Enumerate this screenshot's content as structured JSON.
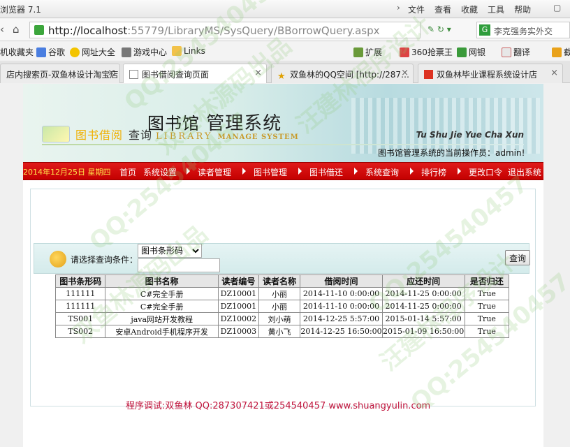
{
  "browser": {
    "app_title": "浏览器 7.1",
    "menu": [
      "文件",
      "查看",
      "收藏",
      "工具",
      "帮助"
    ],
    "url_host": "http://localhost",
    "url_path": ":55779/LibraryMS/SysQuery/BBorrowQuery.aspx",
    "search_text": "李克强务实外交",
    "bookmarks": [
      "机收藏夹",
      "谷歌",
      "网址大全",
      "游戏中心",
      "Links",
      "扩展",
      "360抢票王",
      "网银",
      "翻译",
      "截"
    ],
    "tabs": [
      {
        "label": "店内搜索页-双鱼林设计淘宝店",
        "active": false
      },
      {
        "label": "图书借阅查询页面",
        "active": true
      },
      {
        "label": "双鱼林的QQ空间 [http://287…",
        "active": false
      },
      {
        "label": "双鱼林毕业课程系统设计店",
        "active": false
      }
    ]
  },
  "page": {
    "logo_cn_part1": "图书馆",
    "logo_cn_part2": "管理系统",
    "logo_en_part1": "LIBRARY",
    "logo_en_part2": "MANAGE SYSTEM",
    "operator_text": "图书馆管理系统的当前操作员：admin!",
    "date_text": "2014年12月25日 星期四",
    "nav": [
      "首页",
      "系统设置",
      "读者管理",
      "图书管理",
      "图书借还",
      "系统查询",
      "排行榜",
      "更改口令",
      "退出系统"
    ],
    "section_title_colored": "图书借阅",
    "section_title_plain": "查询",
    "section_pinyin": "Tu Shu Jie Yue Cha Xun",
    "query_label": "请选择查询条件：",
    "query_select_value": "图书条形码",
    "query_input_value": "",
    "query_button": "查询",
    "table": {
      "headers": [
        "图书条形码",
        "图书名称",
        "读者编号",
        "读者名称",
        "借阅时间",
        "应还时间",
        "是否归还"
      ],
      "rows": [
        [
          "111111",
          "C#完全手册",
          "DZ10001",
          "小丽",
          "2014-11-10 0:00:00",
          "2014-11-25 0:00:00",
          "True"
        ],
        [
          "111111",
          "C#完全手册",
          "DZ10001",
          "小丽",
          "2014-11-10 0:00:00",
          "2014-11-25 0:00:00",
          "True"
        ],
        [
          "TS001",
          "java网站开发教程",
          "DZ10002",
          "刘小萌",
          "2014-12-25 5:57:00",
          "2015-01-14 5:57:00",
          "True"
        ],
        [
          "TS002",
          "安卓Android手机程序开发",
          "DZ10003",
          "黄小飞",
          "2014-12-25 16:50:00",
          "2015-01-09 16:50:00",
          "True"
        ]
      ]
    },
    "footer_credit": "程序调试:双鱼林 QQ:287307421或254540457 www.shuangyulin.com",
    "watermarks": [
      "QQ:254540457",
      "双鱼林源码出品",
      "汪建林程序设计",
      "QQ:254540457",
      "双鱼林源码出品",
      "汪建林程序设计",
      "QQ:254540457",
      "QQ:254540457"
    ]
  },
  "colors": {
    "menubar_red": "#d40c0c",
    "date_yellow": "#ffe44a",
    "section_orange": "#f0b000",
    "credit_red": "#c0143c"
  }
}
